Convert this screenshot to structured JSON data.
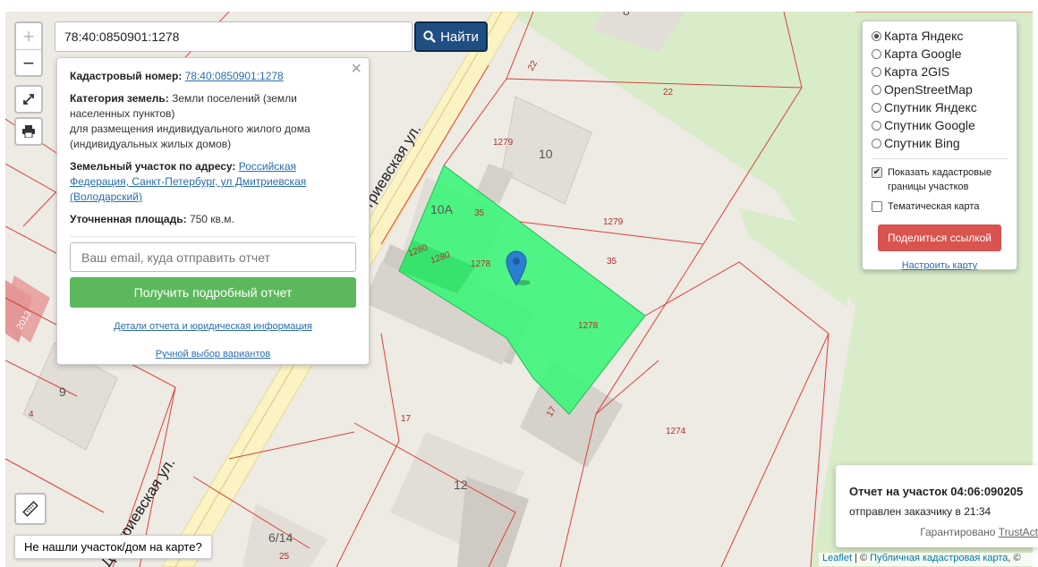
{
  "search": {
    "value": "78:40:0850901:1278",
    "button": "Найти"
  },
  "zoom": {
    "in": "+",
    "out": "−"
  },
  "popup": {
    "cad_label": "Кадастровый номер:",
    "cad_value": "78:40:0850901:1278",
    "cat_label": "Категория земель:",
    "cat_value": "Земли поселений (земли населенных пунктов)",
    "cat_use": "для размещения индивидуального жилого дома (индивидуальных жилых домов)",
    "addr_label": "Земельный участок по адресу:",
    "addr_value": "Российская Федерация, Санкт-Петербург, ул Дмитриевская (Володарский)",
    "area_label": "Уточненная площадь:",
    "area_value": "750 кв.м.",
    "email_placeholder": "Ваш email, куда отправить отчет",
    "report_button": "Получить подробный отчет",
    "details_link": "Детали отчета и юридическая информация",
    "manual_link": "Ручной выбор вариантов",
    "close": "×"
  },
  "layers": {
    "options": [
      {
        "label": "Карта Яндекс",
        "selected": true
      },
      {
        "label": "Карта Google",
        "selected": false
      },
      {
        "label": "Карта 2GIS",
        "selected": false
      },
      {
        "label": "OpenStreetMap",
        "selected": false
      },
      {
        "label": "Спутник Яндекс",
        "selected": false
      },
      {
        "label": "Спутник Google",
        "selected": false
      },
      {
        "label": "Спутник Bing",
        "selected": false
      }
    ],
    "show_cadastral": "Показать кадастровые границы участков",
    "show_cadastral_checked": true,
    "thematic": "Тематическая карта",
    "thematic_checked": false,
    "share_button": "Поделиться ссылкой",
    "setup_link": "Настроить карту"
  },
  "map_labels": {
    "street1": "Дмитриевская ул.",
    "street2": "Дмитриевская ул.",
    "nums": [
      "22",
      "22",
      "1279",
      "1279",
      "35",
      "35",
      "1278",
      "1278",
      "1280",
      "1280",
      "17",
      "17",
      "1274",
      "4",
      "25"
    ],
    "buildings": [
      "10",
      "10А",
      "9",
      "12",
      "6/14",
      "8",
      "2013"
    ]
  },
  "not_found": "Не нашли участок/дом на карте?",
  "toast": {
    "title": "Отчет на участок 04:06:090205",
    "sub": "отправлен заказчику в 21:34",
    "guarantee": "Гарантировано",
    "brand": "TrustAct"
  },
  "attribution": {
    "leaflet": "Leaflet",
    "sep": " | © ",
    "pkk": "Публичная кадастровая карта",
    "tail": ", ©"
  },
  "colors": {
    "parcel": "#3cf57a",
    "find_button": "#1f4f82",
    "report_button": "#5cb85c",
    "share_button": "#d9534f"
  }
}
